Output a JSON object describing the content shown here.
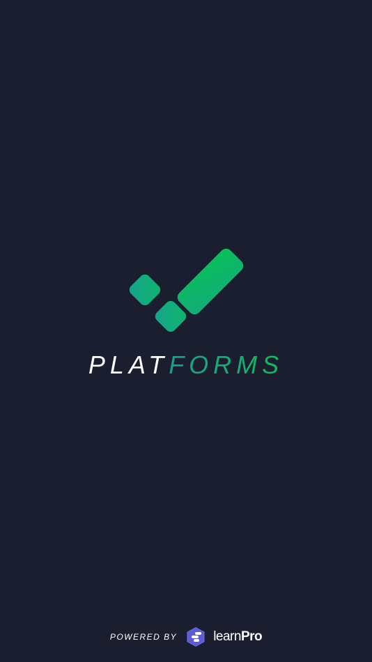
{
  "brand": {
    "wordmark_part_1": "PLAT",
    "wordmark_part_2": "FORMS",
    "logo_icon": "checkmark-tiles-icon",
    "accent_start": "#1a9e8f",
    "accent_end": "#0bbf5a",
    "background": "#1a1e2e"
  },
  "footer": {
    "powered_by": "POWERED BY",
    "partner_icon": "learnpro-hexagon-icon",
    "partner_name_light": "learn",
    "partner_name_bold": "Pro",
    "partner_icon_color": "#5b5bd6"
  }
}
